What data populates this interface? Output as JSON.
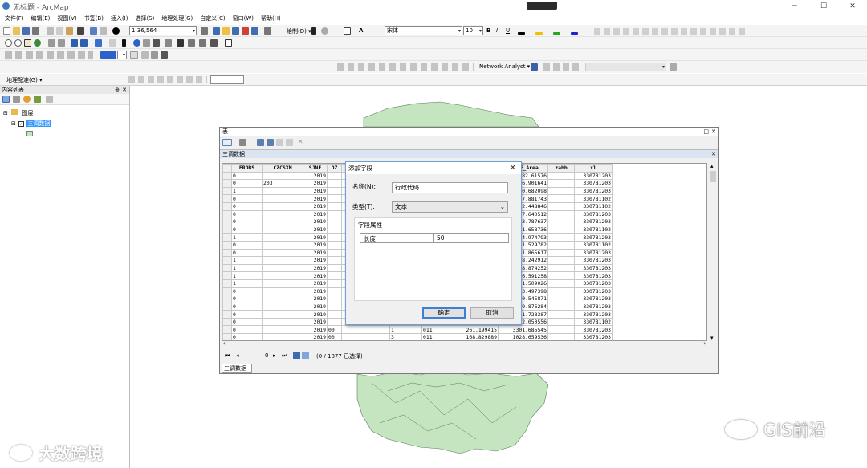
{
  "app": {
    "title": "无标题 - ArcMap"
  },
  "window_controls": {
    "minimize": "─",
    "maximize": "☐",
    "close": "✕"
  },
  "menu": [
    "文件(F)",
    "编辑(E)",
    "视图(V)",
    "书签(B)",
    "插入(I)",
    "选择(S)",
    "地理处理(G)",
    "自定义(C)",
    "窗口(W)",
    "帮助(H)"
  ],
  "toolbar": {
    "scale": "1:36,564",
    "drawing_label": "绘制(D) ▾",
    "font": "宋体",
    "font_size": "10",
    "bold": "B",
    "italic": "I",
    "underline": "U",
    "text_tool": "A",
    "georef_label": "地理配准(G) ▾",
    "network_analyst": "Network Analyst ▾"
  },
  "toc": {
    "title": "内容列表",
    "layers_group": "图层",
    "layer_name": "三调数据"
  },
  "table_window": {
    "title": "表",
    "tab_label": "三调数据",
    "columns": [
      "",
      "FRDBS",
      "CZCSXM",
      "SJNF",
      "DZ",
      "",
      "",
      "",
      "SHAPE_Leng",
      "SHAPE_Area",
      "zabb",
      "xl"
    ],
    "rows": [
      [
        "",
        "0",
        "",
        "2019",
        "",
        "",
        "",
        "",
        "268.724507",
        "1582.61576",
        "",
        "330781203"
      ],
      [
        "",
        "0",
        "203",
        "2019",
        "",
        "",
        "",
        "",
        "112.640617",
        "776.901641",
        "",
        "330781203"
      ],
      [
        "",
        "1",
        "",
        "2019",
        "",
        "",
        "",
        "",
        "498.214288",
        "5570.682098",
        "",
        "330781203"
      ],
      [
        "",
        "0",
        "",
        "2019",
        "",
        "",
        "",
        "",
        "604.252636",
        "15187.881743",
        "",
        "330781102"
      ],
      [
        "",
        "0",
        "",
        "2019",
        "",
        "",
        "",
        "",
        "420.838504",
        "5702.448846",
        "",
        "330781102"
      ],
      [
        "",
        "0",
        "",
        "2019",
        "",
        "",
        "",
        "",
        "421.270793",
        "5337.640512",
        "",
        "330781203"
      ],
      [
        "",
        "0",
        "",
        "2019",
        "",
        "",
        "",
        "",
        "392.837181",
        "3643.787637",
        "",
        "330781203"
      ],
      [
        "",
        "0",
        "",
        "2019",
        "",
        "",
        "",
        "",
        "969.698725",
        "25381.658736",
        "",
        "330781102"
      ],
      [
        "",
        "1",
        "",
        "2019",
        "",
        "",
        "",
        "",
        "456.813255",
        "5534.974793",
        "",
        "330781203"
      ],
      [
        "",
        "0",
        "",
        "2019",
        "",
        "",
        "",
        "",
        "1248.150331",
        "23781.529782",
        "",
        "330781102"
      ],
      [
        "",
        "0",
        "",
        "2019",
        "",
        "",
        "",
        "",
        "275.070705",
        "2941.865617",
        "",
        "330781203"
      ],
      [
        "",
        "1",
        "",
        "2019",
        "",
        "",
        "",
        "",
        "1118.79407",
        "17908.242912",
        "",
        "330781203"
      ],
      [
        "",
        "1",
        "",
        "2019",
        "",
        "",
        "",
        "",
        "1202.988524",
        "15618.874252",
        "",
        "330781203"
      ],
      [
        "",
        "1",
        "",
        "2019",
        "",
        "",
        "",
        "",
        "407.210034",
        "7246.591258",
        "",
        "330781203"
      ],
      [
        "",
        "1",
        "",
        "2019",
        "",
        "",
        "",
        "",
        "536.503375",
        "8061.509026",
        "",
        "330781203"
      ],
      [
        "",
        "0",
        "",
        "2019",
        "",
        "",
        "",
        "",
        "378.405442",
        "6893.497398",
        "",
        "330781203"
      ],
      [
        "",
        "0",
        "",
        "2019",
        "",
        "",
        "",
        "",
        "986.990639",
        "17580.545871",
        "",
        "330781203"
      ],
      [
        "",
        "0",
        "",
        "2019",
        "",
        "",
        "",
        "",
        "602.147809",
        "11639.876284",
        "",
        "330781203"
      ],
      [
        "",
        "0",
        "",
        "2019",
        "",
        "",
        "",
        "",
        "733.682892",
        "15661.728387",
        "",
        "330781203"
      ],
      [
        "",
        "0",
        "",
        "2019",
        "",
        "",
        "",
        "",
        "979.312316",
        "35502.050556",
        "",
        "330781102"
      ],
      [
        "",
        "0",
        "",
        "2019",
        "00",
        "",
        "1",
        "011",
        "261.199415",
        "3301.685545",
        "",
        "330781203"
      ],
      [
        "",
        "0",
        "",
        "2019",
        "00",
        "",
        "3",
        "011",
        "168.829889",
        "1028.659536",
        "",
        "330781203"
      ]
    ],
    "nav": {
      "position": "0",
      "status": "(0 / 1877 已选择)"
    }
  },
  "dialog": {
    "title": "添加字段",
    "name_label": "名称(N):",
    "name_value": "行政代码",
    "type_label": "类型(T):",
    "type_value": "文本",
    "props_label": "字段属性",
    "length_label": "长度",
    "length_value": "50",
    "ok": "确定",
    "cancel": "取消"
  },
  "watermarks": {
    "left": "大数跨境",
    "right": "GIS前沿"
  },
  "colors": {
    "map_fill": "#c5e5c0",
    "selection_blue": "#3399ff",
    "dialog_border": "#6f9fd8"
  }
}
